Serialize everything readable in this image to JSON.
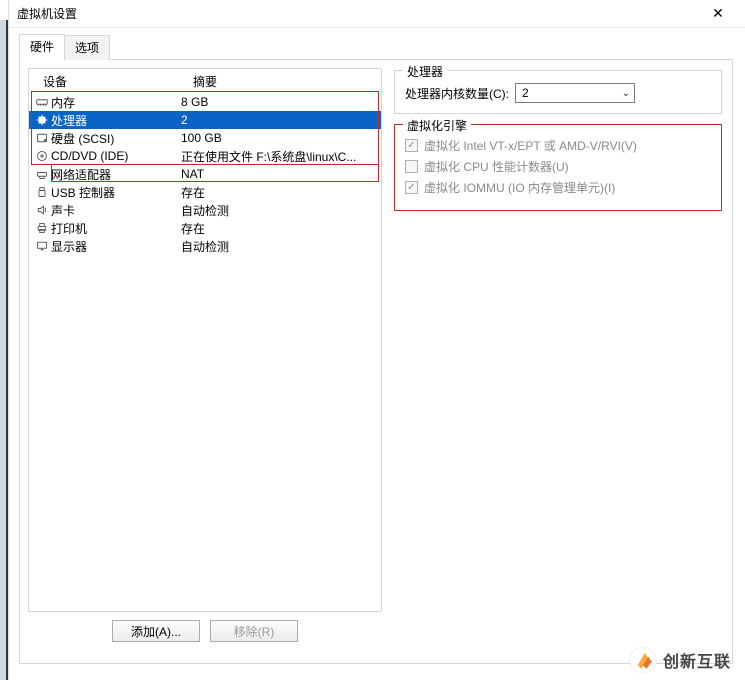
{
  "window": {
    "title": "虚拟机设置"
  },
  "tabs": {
    "hardware": "硬件",
    "options": "选项"
  },
  "device_table": {
    "head_device": "设备",
    "head_summary": "摘要",
    "rows": [
      {
        "name": "内存",
        "summary": "8 GB",
        "icon": "memory",
        "selected": false
      },
      {
        "name": "处理器",
        "summary": "2",
        "icon": "cpu",
        "selected": true
      },
      {
        "name": "硬盘 (SCSI)",
        "summary": "100 GB",
        "icon": "hdd",
        "selected": false
      },
      {
        "name": "CD/DVD (IDE)",
        "summary": "正在使用文件 F:\\系统盘\\linux\\C...",
        "icon": "disc",
        "selected": false
      },
      {
        "name": "网络适配器",
        "summary": "NAT",
        "icon": "net",
        "selected": false
      },
      {
        "name": "USB 控制器",
        "summary": "存在",
        "icon": "usb",
        "selected": false
      },
      {
        "name": "声卡",
        "summary": "自动检测",
        "icon": "sound",
        "selected": false
      },
      {
        "name": "打印机",
        "summary": "存在",
        "icon": "printer",
        "selected": false
      },
      {
        "name": "显示器",
        "summary": "自动检测",
        "icon": "display",
        "selected": false
      }
    ]
  },
  "buttons": {
    "add": "添加(A)...",
    "remove": "移除(R)"
  },
  "processor_panel": {
    "legend": "处理器",
    "cores_label": "处理器内核数量(C):",
    "cores_value": "2"
  },
  "virt_engine_panel": {
    "legend": "虚拟化引擎",
    "opt_vt": "虚拟化 Intel VT-x/EPT 或 AMD-V/RVI(V)",
    "opt_cpu_counters": "虚拟化 CPU 性能计数器(U)",
    "opt_iommu": "虚拟化 IOMMU (IO 内存管理单元)(I)",
    "checked": {
      "vt": true,
      "cpu_counters": false,
      "iommu": true
    }
  },
  "watermark": "创新互联"
}
